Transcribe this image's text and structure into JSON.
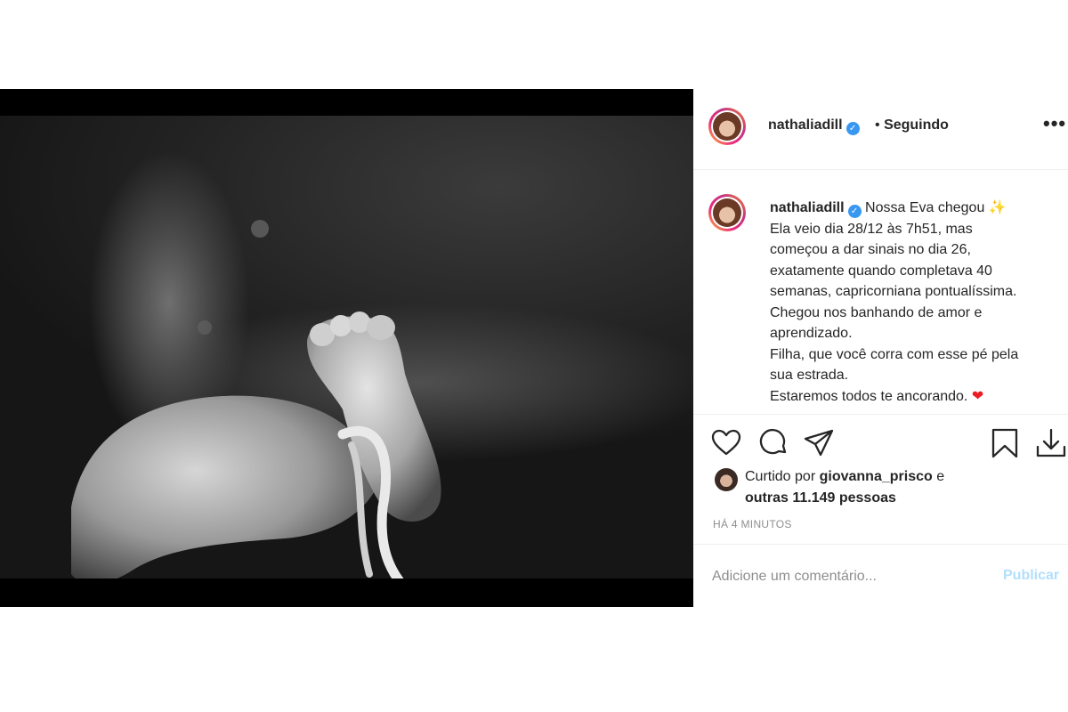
{
  "header": {
    "username": "nathaliadill",
    "separator": "•",
    "follow_status": "Seguindo",
    "more_label": "•••"
  },
  "caption": {
    "username": "nathaliadill",
    "lines": [
      "Nossa Eva chegou",
      "Ela veio dia 28/12 às 7h51, mas",
      "começou a dar sinais no dia 26,",
      "exatamente quando completava 40",
      "semanas, capricorniana pontualíssima.",
      "Chegou nos banhando de amor e",
      "aprendizado.",
      "Filha, que você corra com esse pé pela",
      "sua estrada.",
      "Estaremos todos te ancorando."
    ],
    "emoji_sparkle": "✨",
    "emoji_heart": "❤"
  },
  "actions": {
    "like_icon": "heart-icon",
    "comment_icon": "comment-icon",
    "share_icon": "share-icon",
    "save_icon": "bookmark-icon",
    "download_icon": "download-icon"
  },
  "likes": {
    "prefix": "Curtido por",
    "user": "giovanna_prisco",
    "connector": "e",
    "others": "outras 11.149 pessoas"
  },
  "timestamp": "HÁ 4 MINUTOS",
  "comment": {
    "placeholder": "Adicione um comentário...",
    "publish_label": "Publicar"
  },
  "colors": {
    "verified": "#3897f0",
    "publish_disabled": "#b2dffc",
    "heart": "#ed4956"
  }
}
